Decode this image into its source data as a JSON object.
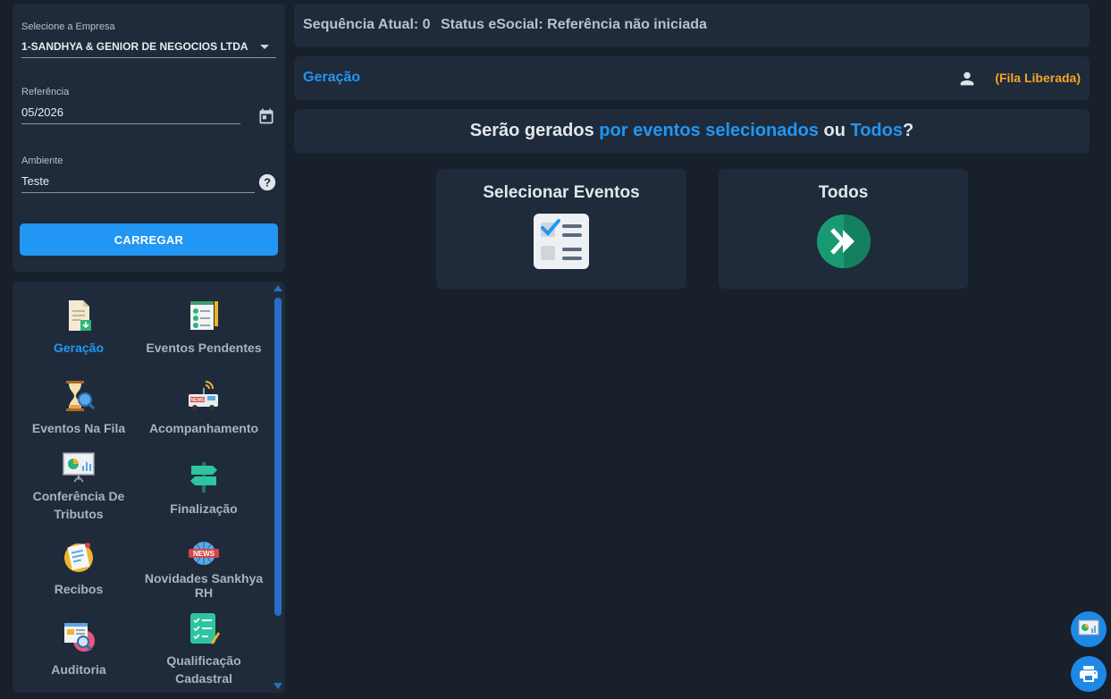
{
  "form": {
    "company_label": "Selecione a Empresa",
    "company_value": "1-SANDHYA & GENIOR DE NEGOCIOS LTDA",
    "reference_label": "Referência",
    "reference_value": "05/2026",
    "environment_label": "Ambiente",
    "environment_value": "Teste",
    "load_button": "CARREGAR"
  },
  "menu": {
    "items": [
      {
        "label": "Geração",
        "icon": "document-download-icon"
      },
      {
        "label": "Eventos Pendentes",
        "icon": "checklist-pencil-icon"
      },
      {
        "label": "Eventos Na Fila",
        "icon": "hourglass-search-icon"
      },
      {
        "label": "Acompanhamento",
        "icon": "news-van-icon"
      },
      {
        "label": "Conferência De Tributos",
        "icon": "presentation-chart-icon"
      },
      {
        "label": "Finalização",
        "icon": "signpost-icon"
      },
      {
        "label": "Recibos",
        "icon": "receipt-icon"
      },
      {
        "label": "Novidades Sankhya RH",
        "icon": "news-globe-icon"
      },
      {
        "label": "Auditoria",
        "icon": "audit-search-icon"
      },
      {
        "label": "Qualificação Cadastral",
        "icon": "clipboard-check-icon"
      }
    ]
  },
  "status": {
    "sequence": "Sequência Atual: 0",
    "esocial": "Status eSocial: Referência não iniciada"
  },
  "generation": {
    "title": "Geração",
    "queue_status": "(Fila Liberada)"
  },
  "question": {
    "prefix": "Serão gerados ",
    "option1": "por eventos selecionados",
    "middle": " ou ",
    "option2": "Todos",
    "suffix": "?"
  },
  "choices": {
    "select_events": "Selecionar Eventos",
    "all": "Todos"
  },
  "colors": {
    "accent": "#2196f3",
    "queue_status": "#f5a623",
    "panel": "#1f2b3b",
    "background": "#18202b"
  }
}
